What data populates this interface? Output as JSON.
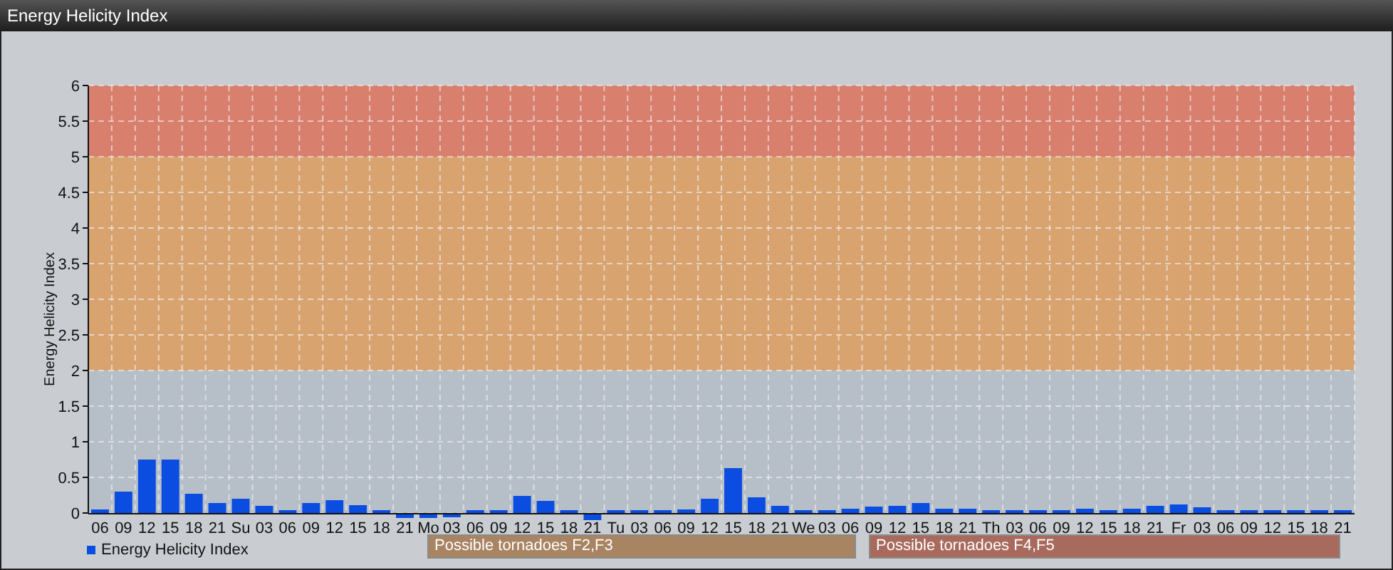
{
  "window": {
    "title": "Energy Helicity Index"
  },
  "chart": {
    "chart_data": {
      "type": "bar",
      "ylabel": "Energy Helicity Index",
      "categories": [
        "06",
        "09",
        "12",
        "15",
        "18",
        "21",
        "Su",
        "03",
        "06",
        "09",
        "12",
        "15",
        "18",
        "21",
        "Mo",
        "03",
        "06",
        "09",
        "12",
        "15",
        "18",
        "21",
        "Tu",
        "03",
        "06",
        "09",
        "12",
        "15",
        "18",
        "21",
        "We",
        "03",
        "06",
        "09",
        "12",
        "15",
        "18",
        "21",
        "Th",
        "03",
        "06",
        "09",
        "12",
        "15",
        "18",
        "21",
        "Fr",
        "03",
        "06",
        "09",
        "12",
        "15",
        "18",
        "21"
      ],
      "series": [
        {
          "name": "Energy Helicity Index",
          "color": "#0a4de0",
          "values": [
            0.05,
            0.3,
            0.75,
            0.75,
            0.27,
            0.14,
            0.2,
            0.1,
            0.04,
            0.14,
            0.18,
            0.11,
            0.04,
            -0.05,
            -0.05,
            -0.04,
            0.04,
            0.04,
            0.24,
            0.17,
            0.04,
            -0.08,
            0.04,
            0.04,
            0.04,
            0.05,
            0.2,
            0.63,
            0.22,
            0.1,
            0.04,
            0.04,
            0.06,
            0.09,
            0.1,
            0.14,
            0.06,
            0.06,
            0.04,
            0.04,
            0.04,
            0.04,
            0.06,
            0.04,
            0.06,
            0.1,
            0.12,
            0.08,
            0.04,
            0.04,
            0.04,
            0.04,
            0.04,
            0.04
          ]
        }
      ],
      "ylim": [
        -0.15,
        6
      ],
      "grid": true,
      "yticks": [
        0,
        0.5,
        1,
        1.5,
        2,
        2.5,
        3,
        3.5,
        4,
        4.5,
        5,
        5.5,
        6
      ],
      "bands": [
        {
          "axis": "y",
          "from": 0,
          "to": 2,
          "color": "#b6bec8"
        },
        {
          "axis": "y",
          "from": 2,
          "to": 5,
          "color": "#d9a370"
        },
        {
          "axis": "y",
          "from": 5,
          "to": 6,
          "color": "#d87f6e"
        }
      ]
    }
  },
  "zones": [
    {
      "label": "Possible tornadoes F2,F3",
      "color": "#a98462"
    },
    {
      "label": "Possible tornadoes F4,F5",
      "color": "#a96a5e"
    }
  ]
}
